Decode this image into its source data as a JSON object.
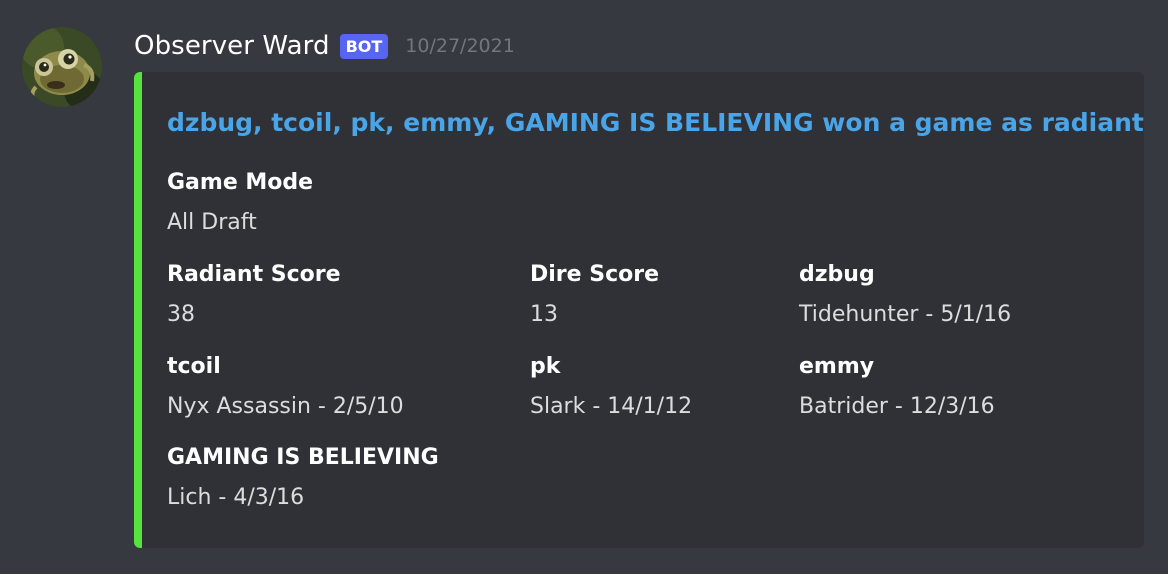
{
  "message": {
    "author": "Observer Ward",
    "badge": "BOT",
    "timestamp": "10/27/2021",
    "avatar_icon": "grub-creature-icon"
  },
  "embed": {
    "accent_color": "#57e33f",
    "title": "dzbug, tcoil, pk, emmy, GAMING IS BELIEVING won a game as radiant",
    "fields": {
      "game_mode": {
        "name": "Game Mode",
        "value": "All Draft"
      },
      "radiant_score": {
        "name": "Radiant Score",
        "value": "38"
      },
      "dire_score": {
        "name": "Dire Score",
        "value": "13"
      },
      "dzbug": {
        "name": "dzbug",
        "value": "Tidehunter - 5/1/16"
      },
      "tcoil": {
        "name": "tcoil",
        "value": "Nyx Assassin - 2/5/10"
      },
      "pk": {
        "name": "pk",
        "value": "Slark - 14/1/12"
      },
      "emmy": {
        "name": "emmy",
        "value": "Batrider - 12/3/16"
      },
      "gaming": {
        "name": "GAMING IS BELIEVING",
        "value": "Lich - 4/3/16"
      }
    }
  },
  "colors": {
    "background": "#36393f",
    "embed_background": "#2f3136",
    "title_link": "#4aa5e8",
    "bot_badge": "#5865f2",
    "timestamp": "#72767d"
  }
}
